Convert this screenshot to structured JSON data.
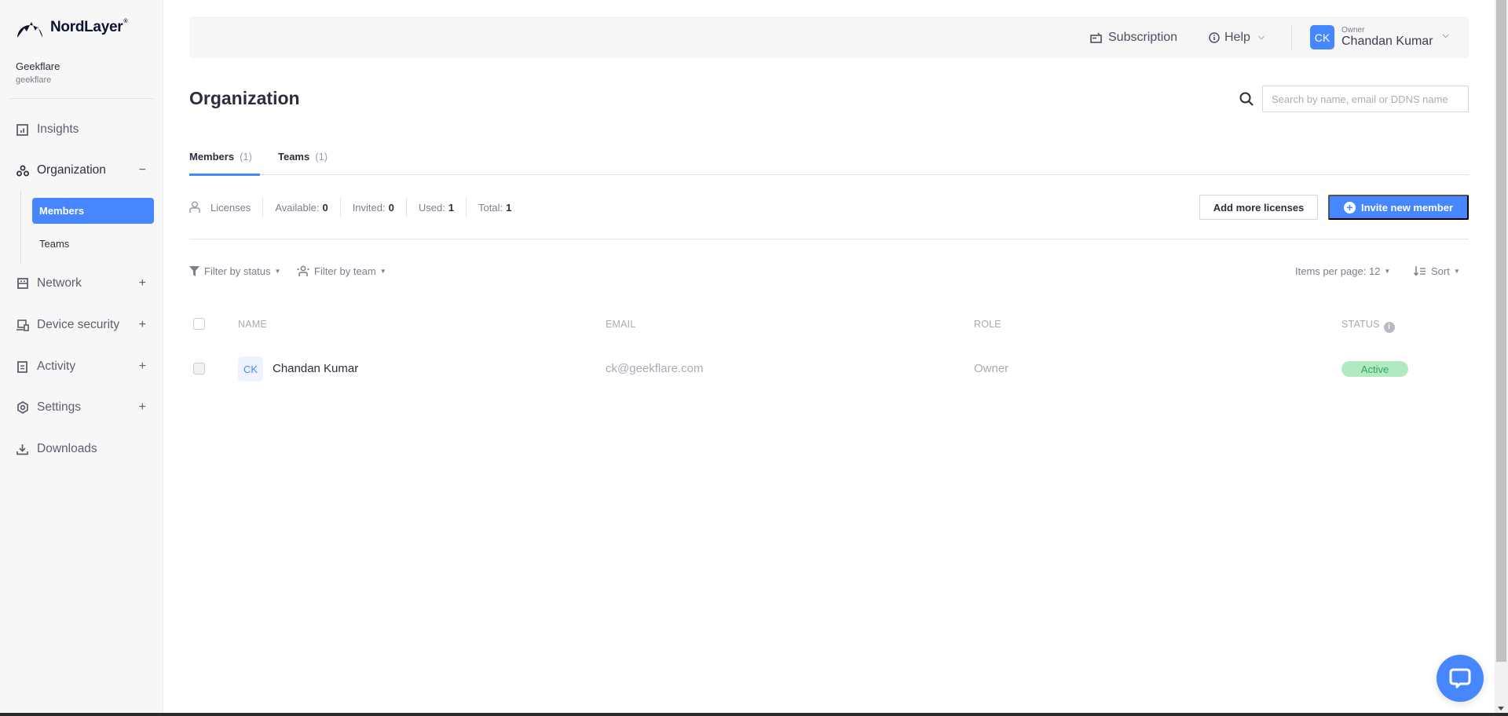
{
  "brand": {
    "name": "NordLayer",
    "reg": "®"
  },
  "org": {
    "name": "Geekflare",
    "slug": "geekflare"
  },
  "sidebar": {
    "items": [
      {
        "label": "Insights",
        "icon": "chart-icon",
        "toggle": ""
      },
      {
        "label": "Organization",
        "icon": "organization-icon",
        "toggle": "−",
        "children": [
          {
            "label": "Members",
            "active": true
          },
          {
            "label": "Teams",
            "active": false
          }
        ]
      },
      {
        "label": "Network",
        "icon": "network-icon",
        "toggle": "+"
      },
      {
        "label": "Device security",
        "icon": "device-security-icon",
        "toggle": "+"
      },
      {
        "label": "Activity",
        "icon": "activity-icon",
        "toggle": "+"
      },
      {
        "label": "Settings",
        "icon": "settings-icon",
        "toggle": "+"
      },
      {
        "label": "Downloads",
        "icon": "download-icon",
        "toggle": ""
      }
    ]
  },
  "topbar": {
    "subscription": "Subscription",
    "help": "Help",
    "user": {
      "initials": "CK",
      "role": "Owner",
      "name": "Chandan Kumar"
    }
  },
  "page": {
    "title": "Organization",
    "search_placeholder": "Search by name, email or DDNS name",
    "search_value": ""
  },
  "tabs": [
    {
      "label": "Members",
      "count": "(1)",
      "active": true
    },
    {
      "label": "Teams",
      "count": "(1)",
      "active": false
    }
  ],
  "licenses": {
    "label": "Licenses",
    "stats": [
      {
        "label": "Available:",
        "value": "0"
      },
      {
        "label": "Invited:",
        "value": "0"
      },
      {
        "label": "Used:",
        "value": "1"
      },
      {
        "label": "Total:",
        "value": "1"
      }
    ],
    "add_button": "Add more licenses",
    "invite_button": "Invite new member"
  },
  "filters": {
    "status": "Filter by status",
    "team": "Filter by team",
    "items_per_page": "Items per page: 12",
    "sort": "Sort"
  },
  "table": {
    "columns": [
      "NAME",
      "EMAIL",
      "ROLE",
      "STATUS"
    ],
    "rows": [
      {
        "initials": "CK",
        "name": "Chandan Kumar",
        "email": "ck@geekflare.com",
        "role": "Owner",
        "status": "Active"
      }
    ]
  },
  "colors": {
    "accent": "#4687ff",
    "status_active_bg": "#b1e9c3",
    "status_active_fg": "#2ea85a",
    "sidebar_bg": "#f7f7f7"
  }
}
